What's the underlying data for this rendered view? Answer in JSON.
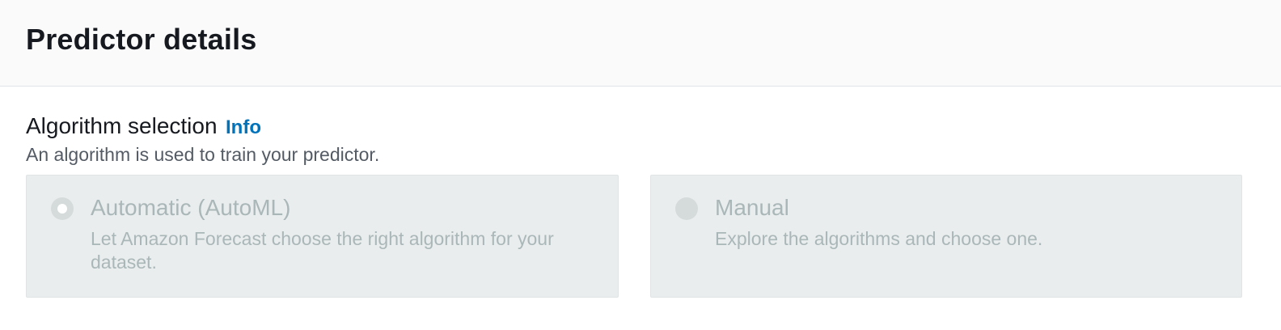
{
  "panel": {
    "title": "Predictor details"
  },
  "algorithm_selection": {
    "label": "Algorithm selection",
    "info_link": "Info",
    "description": "An algorithm is used to train your predictor.",
    "options": [
      {
        "label": "Automatic (AutoML)",
        "description": "Let Amazon Forecast choose the right algorithm for your dataset.",
        "selected": true,
        "disabled": true
      },
      {
        "label": "Manual",
        "description": "Explore the algorithms and choose one.",
        "selected": false,
        "disabled": true
      }
    ]
  },
  "colors": {
    "header_bg": "#fafafa",
    "link": "#0073bb",
    "tile_disabled_bg": "#eaeded",
    "disabled_text": "#aab7b8"
  }
}
